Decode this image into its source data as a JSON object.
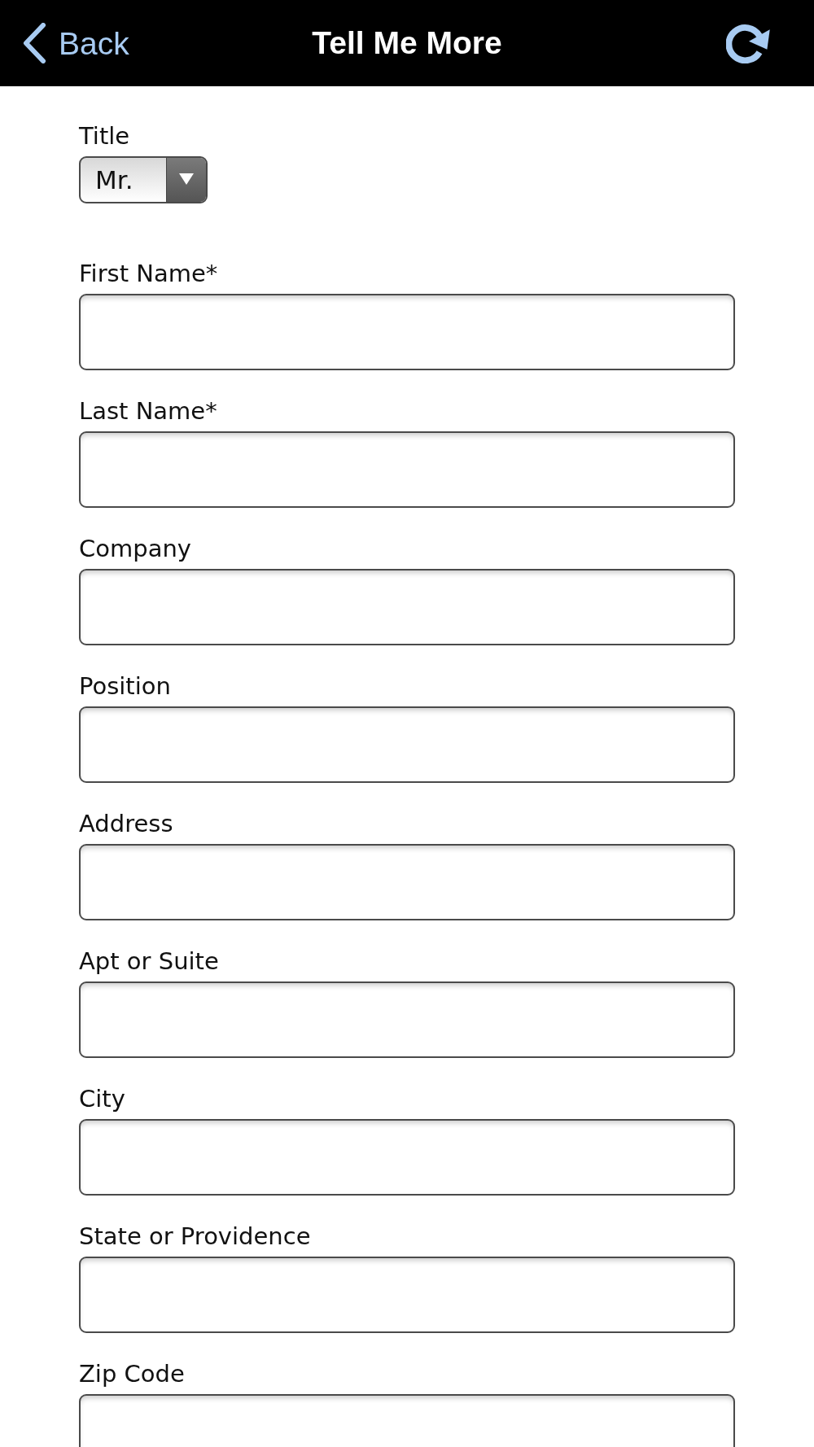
{
  "nav": {
    "back_label": "Back",
    "title": "Tell Me More"
  },
  "title_select": {
    "label": "Title",
    "value": "Mr."
  },
  "fields": [
    {
      "label": "First Name*"
    },
    {
      "label": "Last Name*"
    },
    {
      "label": "Company"
    },
    {
      "label": "Position"
    },
    {
      "label": "Address"
    },
    {
      "label": "Apt or Suite"
    },
    {
      "label": "City"
    },
    {
      "label": "State or Providence"
    },
    {
      "label": "Zip Code"
    }
  ]
}
